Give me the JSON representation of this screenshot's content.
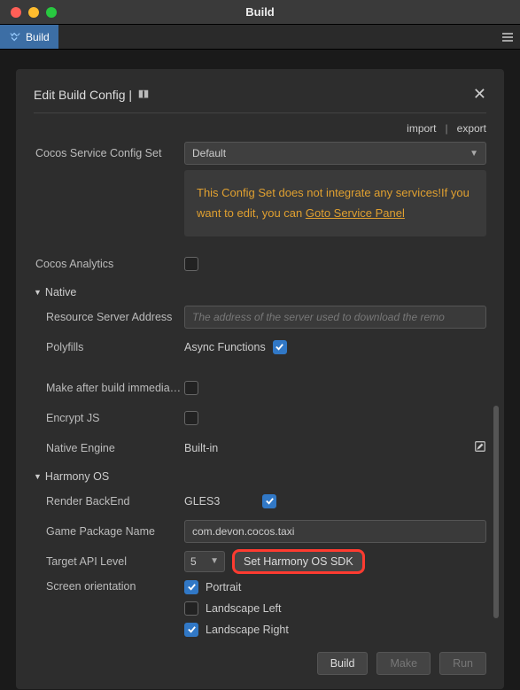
{
  "window": {
    "title": "Build"
  },
  "tab": {
    "label": "Build"
  },
  "panel": {
    "title": "Edit Build Config |"
  },
  "actions": {
    "import": "import",
    "export": "export"
  },
  "configSet": {
    "label": "Cocos Service Config Set",
    "value": "Default",
    "warning_prefix": "This Config Set does not integrate any services!If you want to edit, you can ",
    "warning_link": "Goto Service Panel"
  },
  "analytics": {
    "label": "Cocos Analytics"
  },
  "sections": {
    "native": "Native",
    "harmony": "Harmony OS"
  },
  "native": {
    "resourceServer": {
      "label": "Resource Server Address",
      "placeholder": "The address of the server used to download the remo"
    },
    "polyfills": {
      "label": "Polyfills",
      "value": "Async Functions"
    },
    "makeAfter": {
      "label": "Make after build immedia…"
    },
    "encryptJs": {
      "label": "Encrypt JS"
    },
    "nativeEngine": {
      "label": "Native Engine",
      "value": "Built-in"
    }
  },
  "harmony": {
    "renderBackend": {
      "label": "Render BackEnd",
      "value": "GLES3"
    },
    "packageName": {
      "label": "Game Package Name",
      "value": "com.devon.cocos.taxi"
    },
    "targetApi": {
      "label": "Target API Level",
      "value": "5",
      "sdkButton": "Set Harmony OS SDK"
    },
    "orientation": {
      "label": "Screen orientation",
      "portrait": "Portrait",
      "landscapeLeft": "Landscape Left",
      "landscapeRight": "Landscape Right"
    }
  },
  "footer": {
    "build": "Build",
    "make": "Make",
    "run": "Run"
  }
}
